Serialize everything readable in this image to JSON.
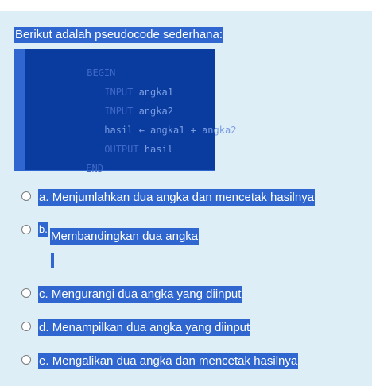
{
  "question": {
    "prompt": "Berikut adalah pseudocode sederhana:"
  },
  "code": {
    "lines": [
      {
        "kw": "BEGIN",
        "rest": ""
      },
      {
        "kw": "INPUT",
        "rest": " angka1"
      },
      {
        "kw": "INPUT",
        "rest": " angka2"
      },
      {
        "kw": "",
        "rest": "hasil ← angka1 + angka2"
      },
      {
        "kw": "OUTPUT",
        "rest": " hasil"
      },
      {
        "kw": "END",
        "rest": ""
      }
    ]
  },
  "options": [
    {
      "letter": "a.",
      "text": "Menjumlahkan dua angka dan mencetak hasilnya",
      "selected": false
    },
    {
      "letter": "b.",
      "text": "Membandingkan dua angka",
      "selected": false
    },
    {
      "letter": "c.",
      "text": "Mengurangi dua angka yang diinput",
      "selected": false
    },
    {
      "letter": "d.",
      "text": "Menampilkan dua angka yang diinput",
      "selected": false
    },
    {
      "letter": "e.",
      "text": "Mengalikan dua angka dan mencetak hasilnya",
      "selected": false
    }
  ],
  "colors": {
    "panel_bg": "#ddeef6",
    "selection": "#2f66cf",
    "code_bg": "#0a3b9f"
  }
}
